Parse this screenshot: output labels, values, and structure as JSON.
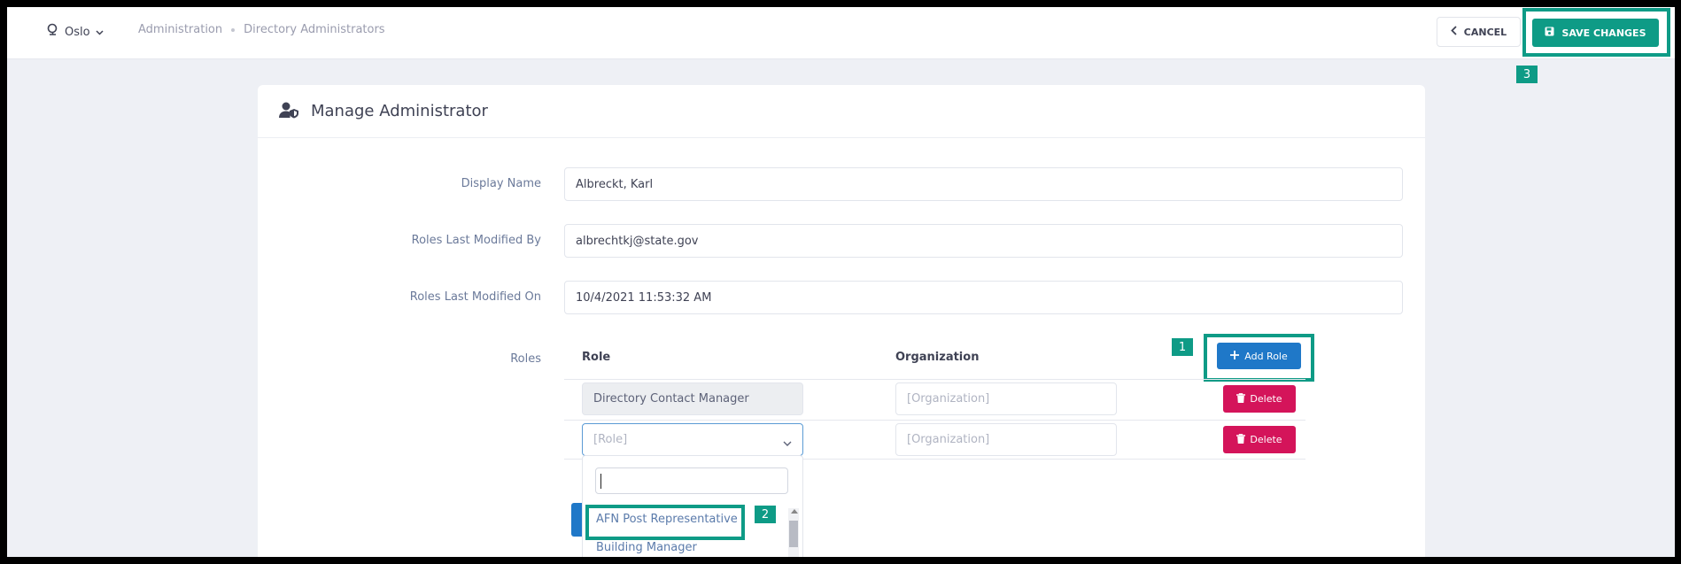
{
  "header": {
    "site": "Oslo",
    "breadcrumbs": [
      "Administration",
      "Directory Administrators"
    ],
    "cancel_label": "CANCEL",
    "save_label": "SAVE CHANGES"
  },
  "annotations": [
    "1",
    "2",
    "3"
  ],
  "card": {
    "title": "Manage Administrator",
    "fields": {
      "display_name_label": "Display Name",
      "display_name_value": "Albreckt, Karl",
      "modified_by_label": "Roles Last Modified By",
      "modified_by_value": "albrechtkj@state.gov",
      "modified_on_label": "Roles Last Modified On",
      "modified_on_value": "10/4/2021 11:53:32 AM",
      "roles_label": "Roles"
    },
    "roles_table": {
      "col_role": "Role",
      "col_org": "Organization",
      "add_label": "Add Role",
      "delete_label": "Delete",
      "rows": [
        {
          "role": "Directory Contact Manager",
          "org_placeholder": "[Organization]"
        },
        {
          "role_placeholder": "[Role]",
          "org_placeholder": "[Organization]"
        }
      ]
    },
    "dropdown": {
      "search_value": "",
      "options": [
        "AFN Post Representative",
        "Building Manager"
      ]
    }
  },
  "colors": {
    "accent": "#0e9b86",
    "primary": "#1f78c8",
    "danger": "#d4145a"
  }
}
